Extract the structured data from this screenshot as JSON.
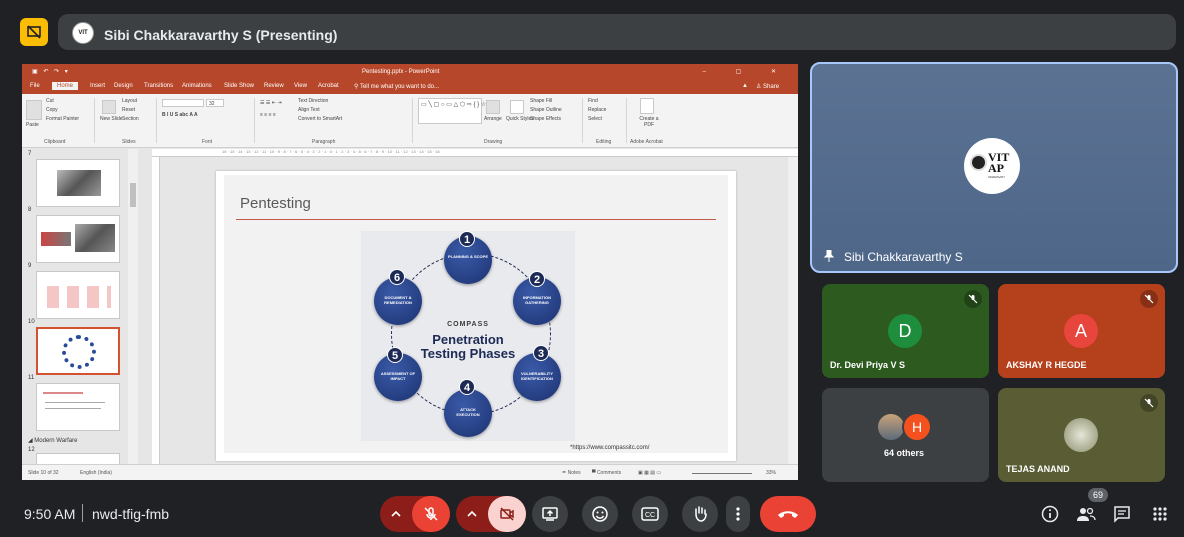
{
  "top": {
    "presenter_name": "Sibi Chakkaravarthy S (Presenting)",
    "presenter_avatar": "VIT"
  },
  "ppt": {
    "filename": "Pentesting.pptx - PowerPoint",
    "tabs": [
      "File",
      "Home",
      "Insert",
      "Design",
      "Transitions",
      "Animations",
      "Slide Show",
      "Review",
      "View",
      "Acrobat"
    ],
    "active_tab": "Home",
    "tell_me": "Tell me what you want to do...",
    "share": "Share",
    "ribbon": {
      "paste": "Paste",
      "cut": "Cut",
      "copy": "Copy",
      "format_painter": "Format Painter",
      "clipboard": "Clipboard",
      "new_slide": "New Slide",
      "layout": "Layout",
      "reset": "Reset",
      "section": "Section",
      "slides": "Slides",
      "font": "Font",
      "paragraph": "Paragraph",
      "text_direction": "Text Direction",
      "align_text": "Align Text",
      "convert_smartart": "Convert to SmartArt",
      "drawing": "Drawing",
      "arrange": "Arrange",
      "quick_styles": "Quick Styles",
      "shape_fill": "Shape Fill",
      "shape_outline": "Shape Outline",
      "shape_effects": "Shape Effects",
      "find": "Find",
      "replace": "Replace",
      "select": "Select",
      "editing": "Editing",
      "create_pdf": "Create a PDF",
      "adobe_acrobat": "Adobe Acrobat",
      "font_size": "32"
    },
    "ruler_text": "16 · 15 · 14 · 13 · 12 · 11 · 10 · 9 · 8 · 7 · 6 · 5 · 4 · 3 · 2 · 1 · 0 · 1 · 2 · 3 · 4 · 5 · 6 · 7 · 8 · 9 · 10 · 11 · 12 · 13 · 14 · 15 · 16",
    "thumb_numbers": [
      "7",
      "8",
      "9",
      "10",
      "11",
      "12"
    ],
    "section_label": "Modern Warfare",
    "slide": {
      "title": "Pentesting",
      "source": "*https://www.compassitc.com/",
      "diagram": {
        "brand": "COMPASS",
        "title_line1": "Penetration",
        "title_line2": "Testing Phases",
        "phases": [
          {
            "num": "1",
            "label": "PLANNING & SCOPE"
          },
          {
            "num": "2",
            "label": "INFORMATION GATHERING"
          },
          {
            "num": "3",
            "label": "VULNERABILITY IDENTIFICATION"
          },
          {
            "num": "4",
            "label": "ATTACK EXECUTION"
          },
          {
            "num": "5",
            "label": "ASSESSMENT OF IMPACT"
          },
          {
            "num": "6",
            "label": "DOCUMENT & REMEDIATION"
          }
        ]
      }
    },
    "status": {
      "slide_info": "Slide 10 of 32",
      "language": "English (India)",
      "notes": "Notes",
      "comments": "Comments",
      "zoom": "33%"
    }
  },
  "tiles": {
    "main_name": "Sibi Chakkaravarthy S",
    "logo_text": "VIT AP",
    "logo_sub": "AMARAVATI",
    "p1_initial": "D",
    "p1_name": "Dr. Devi Priya V S",
    "p2_initial": "A",
    "p2_name": "AKSHAY R HEGDE",
    "others_initial": "H",
    "others_label": "64 others",
    "p3_name": "TEJAS ANAND"
  },
  "bottom": {
    "time": "9:50 AM",
    "meeting_code": "nwd-tfig-fmb",
    "participant_count": "69"
  },
  "colors": {
    "meet_bg": "#202124",
    "ppt_accent": "#b7472a",
    "end_call": "#ea4335",
    "tile_green": "#2d5a1f",
    "tile_orange": "#b5401c",
    "avatar_green": "#1e8e3e",
    "avatar_red": "#e8453c",
    "avatar_orange": "#f4511e"
  }
}
